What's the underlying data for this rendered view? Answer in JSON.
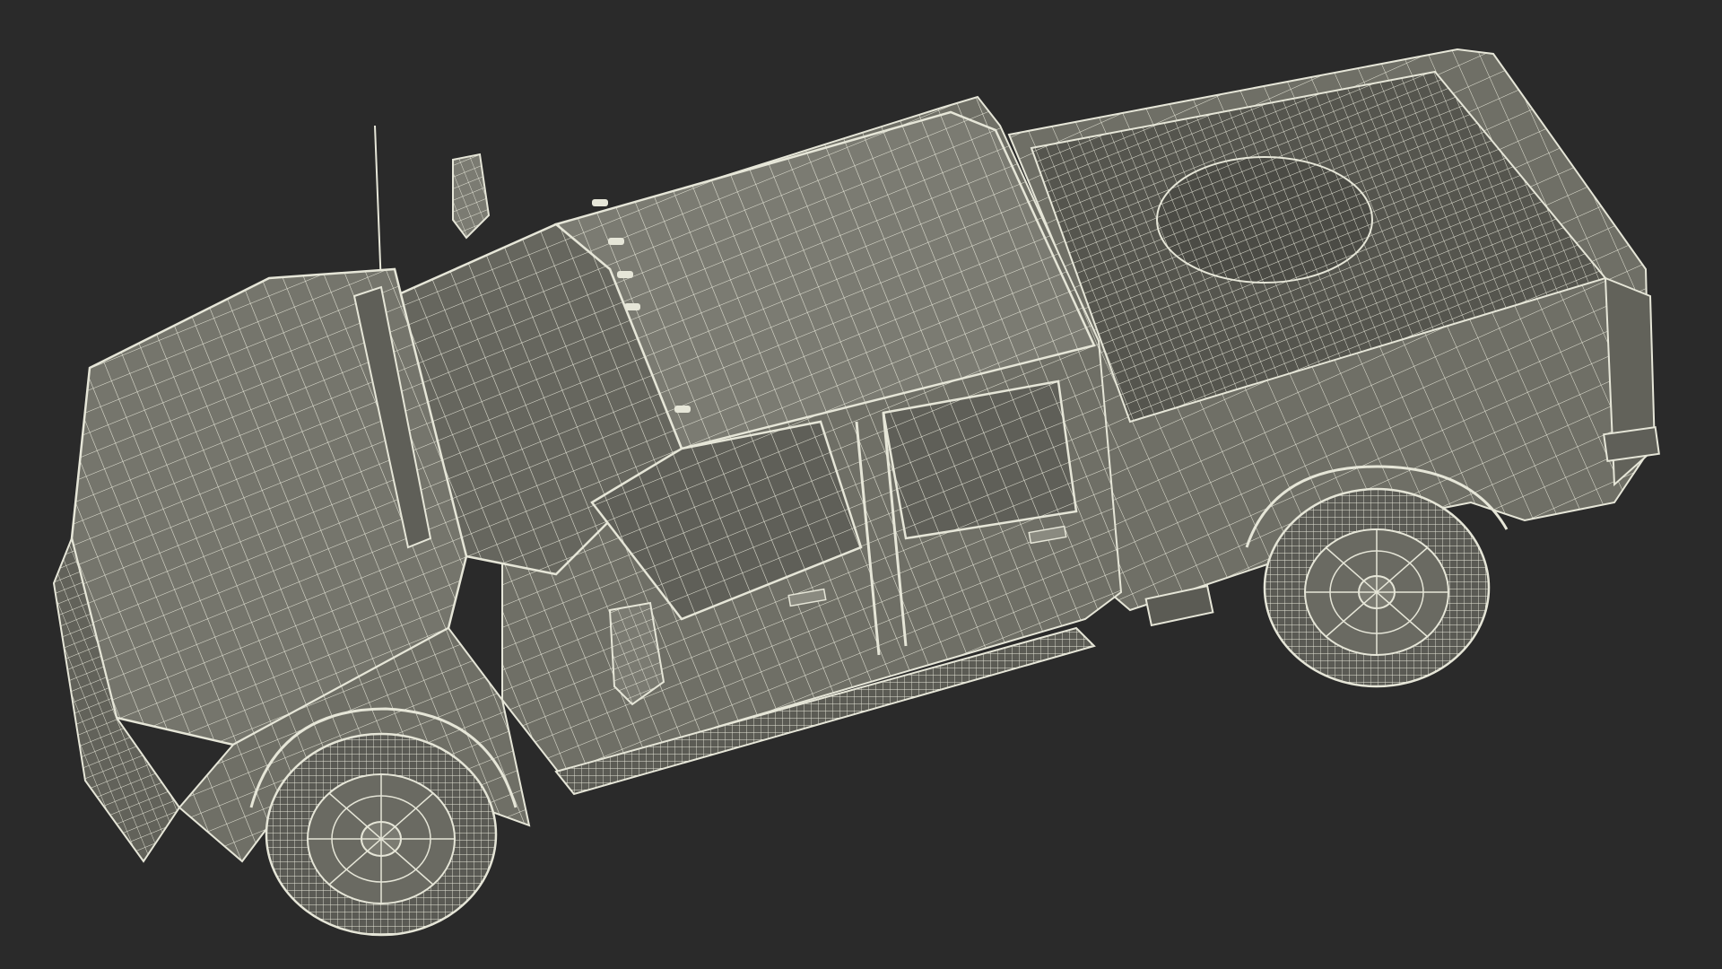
{
  "scene": {
    "subject": "pickup-truck-wireframe-render",
    "colors": {
      "background": "#2a2a2a",
      "surface": "#6f6f66",
      "surface_dark": "#55554e",
      "surface_light": "#84847a",
      "wire": "#e6e6d8",
      "tire": "#5a5a54",
      "cavity": "#3f3f3b"
    }
  }
}
